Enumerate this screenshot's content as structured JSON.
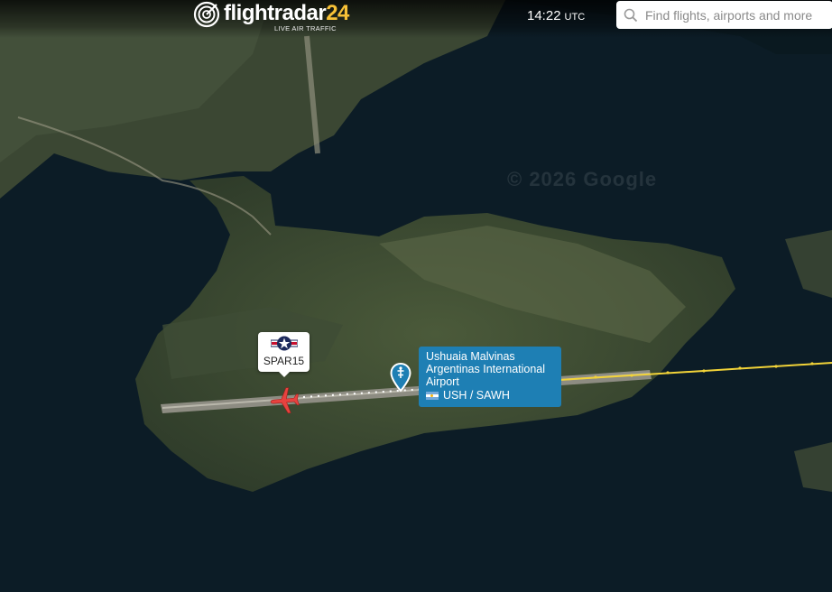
{
  "header": {
    "logo_name": "flightradar",
    "logo_number": "24",
    "logo_tagline": "LIVE AIR TRAFFIC",
    "clock_time": "14:22",
    "clock_zone": "UTC",
    "search_placeholder": "Find flights, airports and more"
  },
  "map": {
    "watermark": "© 2026 Google"
  },
  "flight": {
    "callsign": "SPAR15",
    "icon": "airplane-icon",
    "operator_badge": "us-air-force-roundel-icon",
    "track_colors": [
      "#ffffff",
      "#f2d338"
    ]
  },
  "airport": {
    "name": "Ushuaia Malvinas Argentinas International Airport",
    "codes": "USH / SAWH",
    "country_flag": "argentina-flag-icon",
    "label_color": "#1e7fb4"
  }
}
